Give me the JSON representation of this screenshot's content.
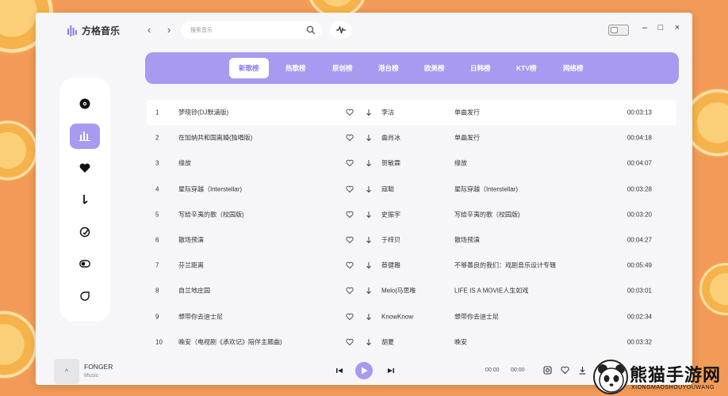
{
  "app": {
    "name": "方格音乐",
    "search_placeholder": "搜索音乐"
  },
  "tabs": [
    {
      "label": "新歌榜",
      "active": true
    },
    {
      "label": "热歌榜",
      "active": false
    },
    {
      "label": "原创榜",
      "active": false
    },
    {
      "label": "港台榜",
      "active": false
    },
    {
      "label": "欧美榜",
      "active": false
    },
    {
      "label": "日韩榜",
      "active": false
    },
    {
      "label": "KTV榜",
      "active": false
    },
    {
      "label": "网络榜",
      "active": false
    }
  ],
  "sidebar": {
    "items": [
      {
        "icon": "disc-icon",
        "active": false
      },
      {
        "icon": "chart-bars-icon",
        "active": true
      },
      {
        "icon": "heart-icon",
        "active": false
      },
      {
        "icon": "download-icon",
        "active": false
      },
      {
        "icon": "compass-icon",
        "active": false
      },
      {
        "icon": "toggle-icon",
        "active": false
      },
      {
        "icon": "leaf-icon",
        "active": false
      }
    ]
  },
  "songs": [
    {
      "index": "1",
      "title": "梦晓铃(DJ默涵版)",
      "artist": "李洁",
      "album": "单曲发行",
      "duration": "00:03:13"
    },
    {
      "index": "2",
      "title": "在加纳共和国离婚(独唱版)",
      "artist": "曲肖冰",
      "album": "单曲发行",
      "duration": "00:04:18"
    },
    {
      "index": "3",
      "title": "缘故",
      "artist": "贺敏霖",
      "album": "缘故",
      "duration": "00:04:07"
    },
    {
      "index": "4",
      "title": "星际穿越（Interstellar)",
      "artist": "寇聪",
      "album": "星际穿越（Interstellar)",
      "duration": "00:03:28"
    },
    {
      "index": "5",
      "title": "写给辛夷的歌（校园版)",
      "artist": "史振宇",
      "album": "写给辛夷的歌（校园版)",
      "duration": "00:03:20"
    },
    {
      "index": "6",
      "title": "散场预演",
      "artist": "于梓贝",
      "album": "散场预演",
      "duration": "00:04:27"
    },
    {
      "index": "7",
      "title": "芬兰距离",
      "artist": "蔡健雅",
      "album": "不够善良的我们：戏剧音乐设计专辑",
      "duration": "00:05:49"
    },
    {
      "index": "8",
      "title": "自兰地庄园",
      "artist": "Melo|马思唯",
      "album": "LIFE IS A MOVIE人生如戏",
      "duration": "00:03:01"
    },
    {
      "index": "9",
      "title": "想带你去迪士尼",
      "artist": "KnowKnow",
      "album": "想带你去迪士尼",
      "duration": "00:02:34"
    },
    {
      "index": "10",
      "title": "晚安（电视剧《承欢记》陪伴主题曲)",
      "artist": "胡夏",
      "album": "晚安",
      "duration": "00:03:32"
    }
  ],
  "player": {
    "song_name": "FONGER",
    "song_artist": "Music",
    "cover_glyph": "^",
    "current_time": "00:00",
    "total_time": "00:00"
  },
  "watermark": {
    "title": "熊猫手游网",
    "subtitle": "XIONGMAOSHOUYOUWANG"
  },
  "colors": {
    "accent": "#a79af0",
    "background": "#f29a57",
    "panel": "#f6f6f9"
  }
}
